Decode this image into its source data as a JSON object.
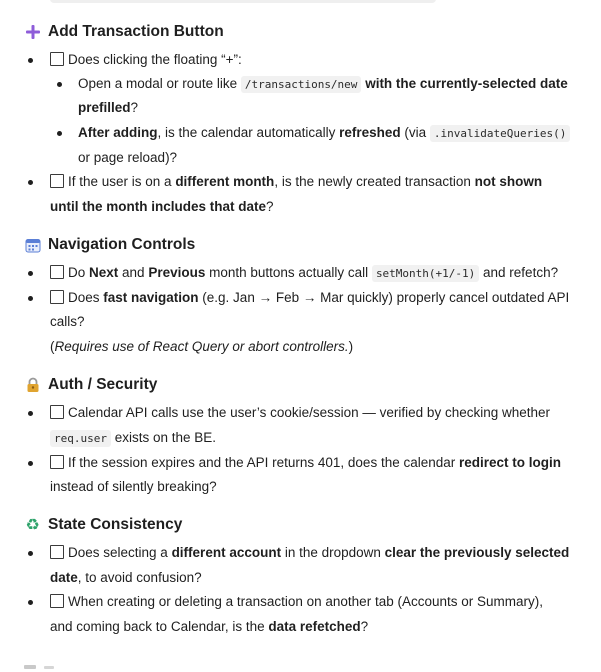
{
  "sections": {
    "add_tx": {
      "title": "Add Transaction Button",
      "icon": "plus-icon",
      "item1": {
        "a": "Does clicking the floating “+”:",
        "sub1": {
          "a": "Open a modal or route like ",
          "code": "/transactions/new",
          "b": " with the currently-selected date",
          "c": "prefilled",
          "d": "?"
        },
        "sub2": {
          "a": "After adding",
          "b": ", is the calendar automatically ",
          "c": "refreshed",
          "d": " (via ",
          "code": ".invalidateQueries()",
          "e": "or page reload)?"
        }
      },
      "item2": {
        "a": "If the user is on a ",
        "b": "different month",
        "c": ", is the newly created transaction ",
        "d": "not shown",
        "e": "until the month includes that date",
        "f": "?"
      }
    },
    "nav": {
      "title": "Navigation Controls",
      "icon": "calendar-icon",
      "item1": {
        "a": "Do ",
        "b": "Next",
        "c": " and ",
        "d": "Previous",
        "e": " month buttons actually call ",
        "code": "setMonth(+1/-1)",
        "f": " and refetch?"
      },
      "item2": {
        "a": "Does ",
        "b": "fast navigation",
        "c": " (e.g. Jan → Feb → Mar quickly) properly cancel outdated API",
        "d": "calls?",
        "note_a": "(",
        "note_b": "Requires use of React Query or abort controllers.",
        "note_c": ")"
      }
    },
    "auth": {
      "title": "Auth / Security",
      "icon": "lock-icon",
      "item1": {
        "a": "Calendar API calls use the user’s cookie/session — verified by checking whether",
        "code": "req.user",
        "b": " exists on the BE."
      },
      "item2": {
        "a": "If the session expires and the API returns 401, does the calendar ",
        "b": "redirect to login",
        "c": "instead of silently breaking?"
      }
    },
    "state": {
      "title": "State Consistency",
      "icon": "recycle-icon",
      "item1": {
        "a": "Does selecting a ",
        "b": "different account",
        "c": " in the dropdown ",
        "d": "clear the previously selected",
        "e": "date",
        "f": ", to avoid confusion?"
      },
      "item2": {
        "a": "When creating or deleting a transaction on another tab (Accounts or Summary),",
        "b": "and coming back to Calendar, is the ",
        "c": "data refetched",
        "d": "?"
      }
    }
  },
  "colors": {
    "text": "#1f1f1f",
    "plus_icon": "#8e5cd9",
    "calendar_icon": "#5b7fd6",
    "lock_icon": "#e0a430",
    "recycle_icon": "#2fa36b"
  }
}
